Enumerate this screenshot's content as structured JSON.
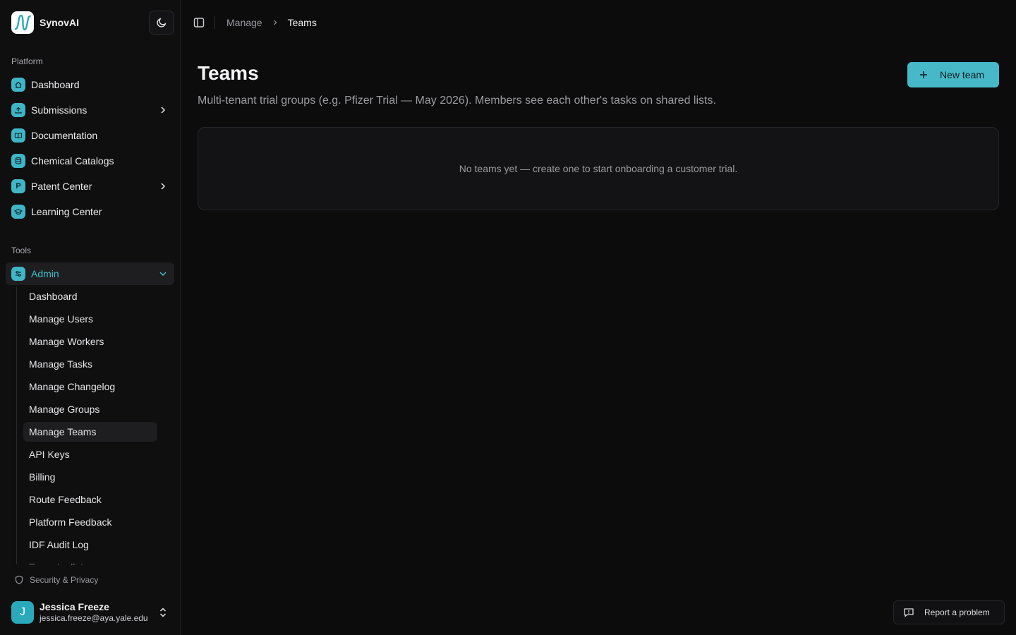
{
  "brand": {
    "name": "SynovAI"
  },
  "sidebar": {
    "platform_label": "Platform",
    "platform_items": [
      {
        "label": "Dashboard",
        "icon": "home-icon"
      },
      {
        "label": "Submissions",
        "icon": "upload-icon",
        "expandable": true
      },
      {
        "label": "Documentation",
        "icon": "book-icon"
      },
      {
        "label": "Chemical Catalogs",
        "icon": "database-icon"
      },
      {
        "label": "Patent Center",
        "icon": "p-letter-icon",
        "glyph": "P",
        "expandable": true
      },
      {
        "label": "Learning Center",
        "icon": "graduation-cap-icon"
      }
    ],
    "tools_label": "Tools",
    "admin": {
      "label": "Admin",
      "expanded": true,
      "subitems": [
        "Dashboard",
        "Manage Users",
        "Manage Workers",
        "Manage Tasks",
        "Manage Changelog",
        "Manage Groups",
        "Manage Teams",
        "API Keys",
        "Billing",
        "Route Feedback",
        "Platform Feedback",
        "IDF Audit Log",
        "Team Audit Log"
      ],
      "active_subitem": "Manage Teams"
    },
    "security_label": "Security & Privacy",
    "user": {
      "initial": "J",
      "name": "Jessica Freeze",
      "email": "jessica.freeze@aya.yale.edu"
    }
  },
  "breadcrumb": {
    "parent": "Manage",
    "current": "Teams"
  },
  "main": {
    "title": "Teams",
    "subtitle": "Multi-tenant trial groups (e.g. Pfizer Trial — May 2026). Members see each other's tasks on shared lists.",
    "new_button_label": "New team",
    "empty_message": "No teams yet — create one to start onboarding a customer trial."
  },
  "report_button_label": "Report a problem",
  "colors": {
    "background": "#0c0c0d",
    "sidebar": "#0f0f10",
    "accent": "#47b8c8",
    "active_text": "#41c0d0"
  }
}
